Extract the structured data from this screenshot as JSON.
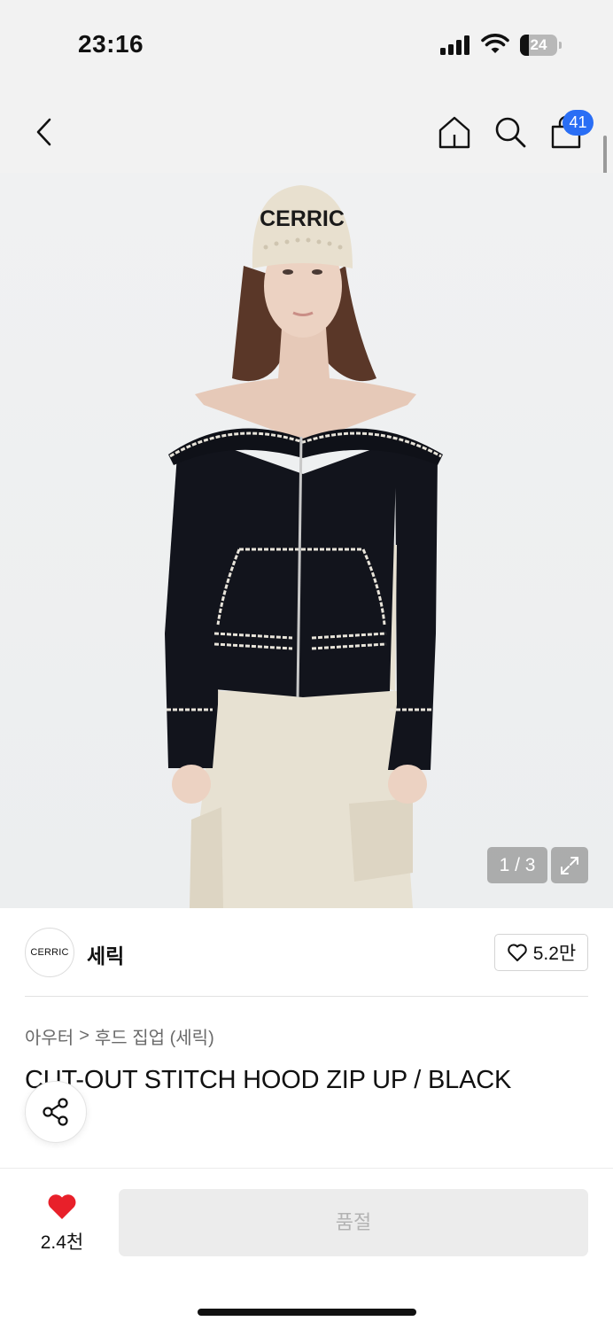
{
  "status": {
    "time": "23:16",
    "battery": 24,
    "battery_level": 0.24
  },
  "nav": {
    "cart_count": "41"
  },
  "gallery": {
    "counter": "1 / 3",
    "current": 1,
    "total": 3,
    "hat_text": "CERRIC",
    "colors": {
      "jacket": "#12141c",
      "stitch": "#e8e4da",
      "pants": "#e7e1d2",
      "hair": "#5a3728",
      "skin": "#e6c9b8"
    }
  },
  "brand": {
    "logo_text": "CERRIC",
    "name": "세릭",
    "likes": "5.2만"
  },
  "breadcrumb": {
    "category": "아우터",
    "separator": ">",
    "subcategory": "후드 집업 (세릭)"
  },
  "product": {
    "title": "CUT-OUT STITCH HOOD ZIP UP / BLACK"
  },
  "bottom": {
    "wish_count": "2.4천",
    "buy_label": "품절",
    "accent": "#e8202a"
  },
  "icons": [
    "back-arrow-icon",
    "home-icon",
    "search-icon",
    "shopping-bag-icon",
    "expand-icon",
    "heart-outline-icon",
    "share-icon",
    "heart-filled-icon"
  ]
}
